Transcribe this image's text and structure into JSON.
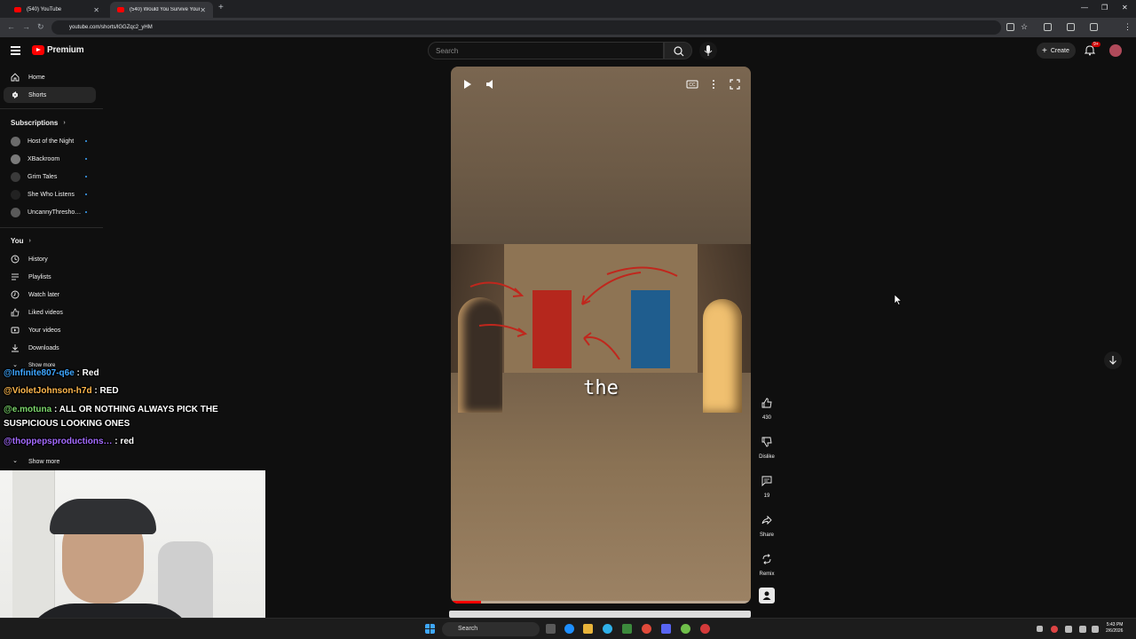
{
  "browser": {
    "tabs": [
      {
        "title": "(540) YouTube"
      },
      {
        "title": "(540) Would You Survive Your D…"
      }
    ],
    "url": "youtube.com/shorts/lGGZqc2_yHM"
  },
  "header": {
    "logo_text": "Premium",
    "search_placeholder": "Search",
    "create_label": "Create",
    "notif_count": "9+"
  },
  "sidebar": {
    "primary": [
      {
        "label": "Home",
        "icon": "home-icon"
      },
      {
        "label": "Shorts",
        "icon": "shorts-icon",
        "active": true
      }
    ],
    "subscriptions_heading": "Subscriptions",
    "subscriptions": [
      {
        "label": "Host of the Night",
        "color": "#6b6b6b"
      },
      {
        "label": "XBackroom",
        "color": "#7a7a7a"
      },
      {
        "label": "Grim Tales",
        "color": "#3a3a3a"
      },
      {
        "label": "She Who Listens",
        "color": "#222222"
      },
      {
        "label": "UncannyThresho…",
        "color": "#5a5a5a"
      }
    ],
    "you_heading": "You",
    "you_items": [
      {
        "label": "History",
        "icon": "history-icon"
      },
      {
        "label": "Playlists",
        "icon": "playlists-icon"
      },
      {
        "label": "Watch later",
        "icon": "watch-later-icon"
      },
      {
        "label": "Liked videos",
        "icon": "liked-icon"
      },
      {
        "label": "Your videos",
        "icon": "your-videos-icon"
      },
      {
        "label": "Downloads",
        "icon": "downloads-icon"
      }
    ],
    "show_more_1": "Show more",
    "show_more_2": "Show more"
  },
  "chat": [
    {
      "user": "@Infinite807-q6e",
      "user_color": "#3ea6ff",
      "sep": " : ",
      "msg": "Red"
    },
    {
      "user": "@VioletJohnson-h7d",
      "user_color": "#ffb84d",
      "sep": " : ",
      "msg": "RED"
    },
    {
      "user": "@e.motuna",
      "user_color": "#7bd66b",
      "sep": " : ",
      "msg": "ALL OR NOTHING ALWAYS PICK THE"
    },
    {
      "user": "",
      "user_color": "#ffffff",
      "sep": "",
      "msg": "SUSPICIOUS LOOKING ONES"
    },
    {
      "user": "@thoppepsproductions…",
      "user_color": "#a46bff",
      "sep": " : ",
      "msg": "red"
    }
  ],
  "video": {
    "caption": "the",
    "progress": 0.1,
    "door_colors": {
      "left": "#b5271d",
      "right": "#1f5d8e"
    }
  },
  "actions": {
    "like_count": "430",
    "dislike_label": "Dislike",
    "comment_count": "19",
    "share_label": "Share",
    "remix_label": "Remix"
  },
  "taskbar": {
    "search_label": "Search",
    "time": "5:43 PM",
    "date": "2/6/2026"
  },
  "colors": {
    "accent": "#ff0000",
    "background": "#0f0f0f"
  }
}
